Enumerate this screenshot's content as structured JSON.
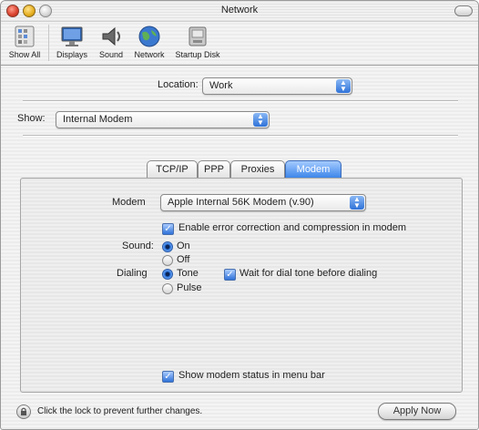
{
  "window": {
    "title": "Network"
  },
  "toolbar": {
    "items": [
      {
        "label": "Show All",
        "icon": "show-all-icon"
      },
      {
        "label": "Displays",
        "icon": "displays-icon"
      },
      {
        "label": "Sound",
        "icon": "sound-icon"
      },
      {
        "label": "Network",
        "icon": "network-icon"
      },
      {
        "label": "Startup Disk",
        "icon": "startup-disk-icon"
      }
    ]
  },
  "location": {
    "label": "Location:",
    "value": "Work"
  },
  "show": {
    "label": "Show:",
    "value": "Internal Modem"
  },
  "tabs": [
    {
      "label": "TCP/IP",
      "active": false
    },
    {
      "label": "PPP",
      "active": false
    },
    {
      "label": "Proxies",
      "active": false
    },
    {
      "label": "Modem",
      "active": true
    }
  ],
  "modem_panel": {
    "modem_label": "Modem",
    "modem_value": "Apple Internal 56K Modem (v.90)",
    "error_correction_label": "Enable error correction and compression in modem",
    "error_correction_checked": true,
    "sound_label": "Sound:",
    "sound_options": [
      "On",
      "Off"
    ],
    "sound_selected": "On",
    "dialing_label": "Dialing",
    "dialing_options": [
      "Tone",
      "Pulse"
    ],
    "dialing_selected": "Tone",
    "wait_dial_tone_label": "Wait for dial tone before dialing",
    "wait_dial_tone_checked": true,
    "show_status_label": "Show modem status in menu bar",
    "show_status_checked": true
  },
  "footer": {
    "lock_text": "Click the lock to prevent further changes.",
    "apply_label": "Apply Now"
  },
  "colors": {
    "accent": "#3d86ea",
    "close": "#d8402b",
    "minimize": "#e5ad1e"
  }
}
